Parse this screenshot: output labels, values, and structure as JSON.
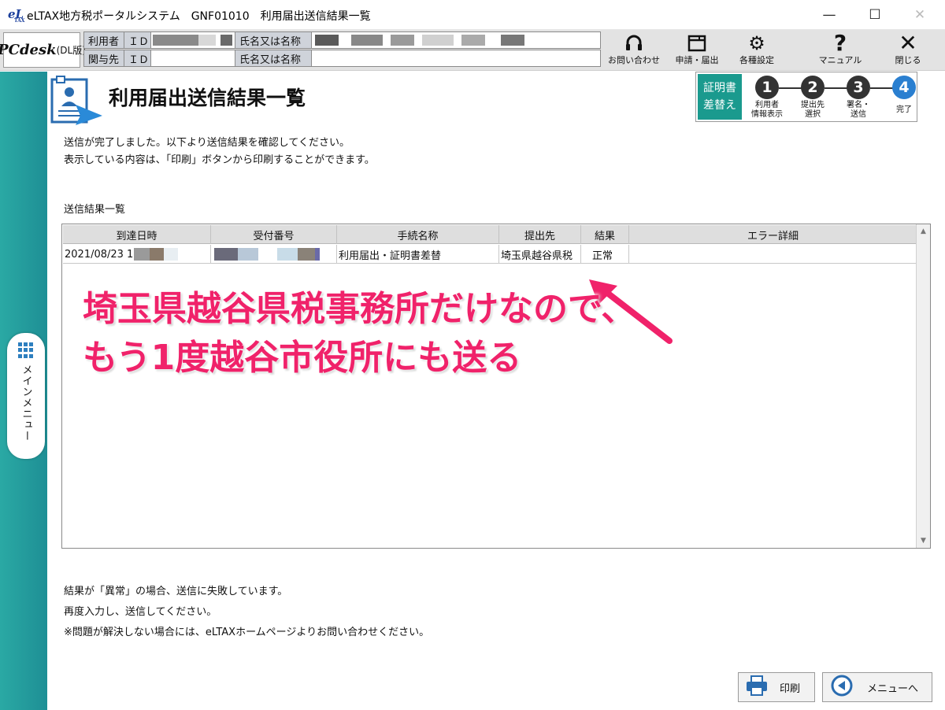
{
  "window": {
    "logo": "eL",
    "logo_sub": "TAX",
    "title": "eLTAX地方税ポータルシステム　GNF01010　利用届出送信結果一覧",
    "minimize": "—",
    "maximize": "☐",
    "close": "✕"
  },
  "header": {
    "product": "PCdesk",
    "product_sub": "(DL版)",
    "user_label": "利用者",
    "involved_label": "関与先",
    "id_label": "ＩＤ",
    "name_label": "氏名又は名称",
    "tools": [
      {
        "label": "お問い合わせ",
        "icon": "headset-icon",
        "glyph": "🎧"
      },
      {
        "label": "申請・届出",
        "icon": "window-icon",
        "glyph": "▣"
      },
      {
        "label": "各種設定",
        "icon": "gear-icon",
        "glyph": "⚙"
      },
      {
        "label": "マニュアル",
        "icon": "question-icon",
        "glyph": "?"
      },
      {
        "label": "閉じる",
        "icon": "close-icon",
        "glyph": "✕"
      }
    ]
  },
  "sidebar": {
    "menu_label": "メインメニュー"
  },
  "page": {
    "title": "利用届出送信結果一覧",
    "cert_button": [
      "証明書",
      "差替え"
    ],
    "steps": [
      {
        "num": "1",
        "label1": "利用者",
        "label2": "情報表示",
        "active": false
      },
      {
        "num": "2",
        "label1": "提出先",
        "label2": "選択",
        "active": false
      },
      {
        "num": "3",
        "label1": "署名・",
        "label2": "送信",
        "active": false
      },
      {
        "num": "4",
        "label1": "完了",
        "label2": "",
        "active": true
      }
    ],
    "intro": [
      "送信が完了しました。以下より送信結果を確認してください。",
      "表示している内容は、「印刷」ボタンから印刷することができます。"
    ],
    "list_label": "送信結果一覧",
    "notes": [
      "結果が「異常」の場合、送信に失敗しています。",
      "再度入力し、送信してください。",
      "※問題が解決しない場合には、eLTAXホームページよりお問い合わせください。"
    ]
  },
  "table": {
    "columns": [
      "到達日時",
      "受付番号",
      "手続名称",
      "提出先",
      "結果",
      "エラー詳細"
    ],
    "rows": [
      {
        "date": "2021/08/23 1",
        "receipt": "",
        "procedure": "利用届出・証明書差替",
        "destination": "埼玉県越谷県税",
        "result": "正常",
        "error": ""
      }
    ]
  },
  "annotation": {
    "line1": "埼玉県越谷県税事務所だけなので、",
    "line2": "もう1度越谷市役所にも送る",
    "color": "#f0226a"
  },
  "footer": {
    "print_label": "印刷",
    "menu_label": "メニューへ"
  }
}
